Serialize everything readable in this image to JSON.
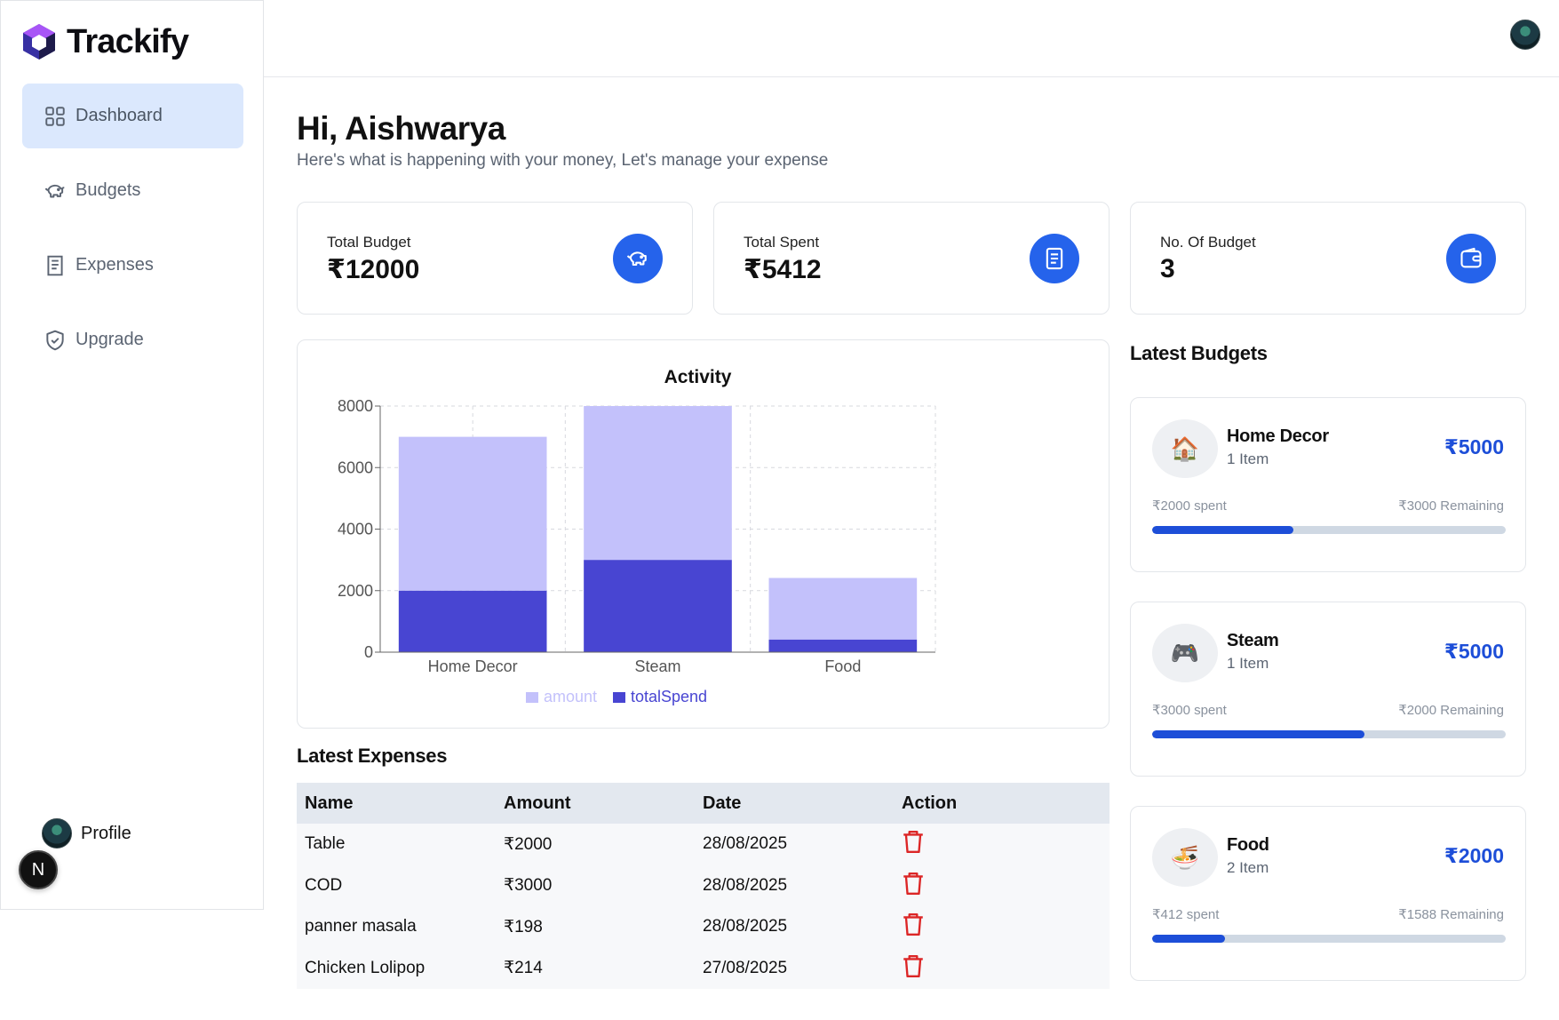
{
  "app": {
    "name": "Trackify"
  },
  "sidebar": {
    "items": [
      {
        "label": "Dashboard",
        "icon": "dashboard-icon",
        "active": true
      },
      {
        "label": "Budgets",
        "icon": "piggy-bank-icon"
      },
      {
        "label": "Expenses",
        "icon": "receipt-icon"
      },
      {
        "label": "Upgrade",
        "icon": "shield-check-icon"
      }
    ],
    "profile_label": "Profile",
    "dev_badge": "N"
  },
  "header": {
    "greeting": "Hi, Aishwarya",
    "subtitle": "Here's what is happening with your money, Let's manage your expense"
  },
  "stats": [
    {
      "label": "Total Budget",
      "value": "₹12000",
      "icon": "piggy-bank-icon"
    },
    {
      "label": "Total Spent",
      "value": "₹5412",
      "icon": "receipt-icon"
    },
    {
      "label": "No. Of Budget",
      "value": "3",
      "icon": "wallet-icon"
    }
  ],
  "chart_data": {
    "type": "bar",
    "title": "Activity",
    "categories": [
      "Home Decor",
      "Steam",
      "Food"
    ],
    "series": [
      {
        "name": "amount",
        "values": [
          5000,
          5000,
          2000
        ],
        "color": "#c3c1fb"
      },
      {
        "name": "totalSpend",
        "values": [
          2000,
          3000,
          412
        ],
        "color": "#4845d2"
      }
    ],
    "stacked": true,
    "ylim": [
      0,
      8000
    ],
    "yticks": [
      0,
      2000,
      4000,
      6000,
      8000
    ],
    "grid": true,
    "legend": "bottom"
  },
  "latest_expenses": {
    "title": "Latest Expenses",
    "columns": [
      "Name",
      "Amount",
      "Date",
      "Action"
    ],
    "rows": [
      {
        "name": "Table",
        "amount": "₹2000",
        "date": "28/08/2025"
      },
      {
        "name": "COD",
        "amount": "₹3000",
        "date": "28/08/2025"
      },
      {
        "name": "panner masala",
        "amount": "₹198",
        "date": "28/08/2025"
      },
      {
        "name": "Chicken Lolipop",
        "amount": "₹214",
        "date": "27/08/2025"
      }
    ]
  },
  "latest_budgets": {
    "title": "Latest Budgets",
    "items": [
      {
        "emoji": "🏠",
        "name": "Home Decor",
        "items": "1 Item",
        "amount": "₹5000",
        "spent": "₹2000 spent",
        "remaining": "₹3000 Remaining",
        "progress": 0.4
      },
      {
        "emoji": "🎮",
        "name": "Steam",
        "items": "1 Item",
        "amount": "₹5000",
        "spent": "₹3000 spent",
        "remaining": "₹2000 Remaining",
        "progress": 0.6
      },
      {
        "emoji": "🍜",
        "name": "Food",
        "items": "2 Item",
        "amount": "₹2000",
        "spent": "₹412 spent",
        "remaining": "₹1588 Remaining",
        "progress": 0.206
      }
    ]
  },
  "colors": {
    "accent": "#2563eb",
    "danger": "#dc2626",
    "active_nav": "#dbe8fd"
  }
}
